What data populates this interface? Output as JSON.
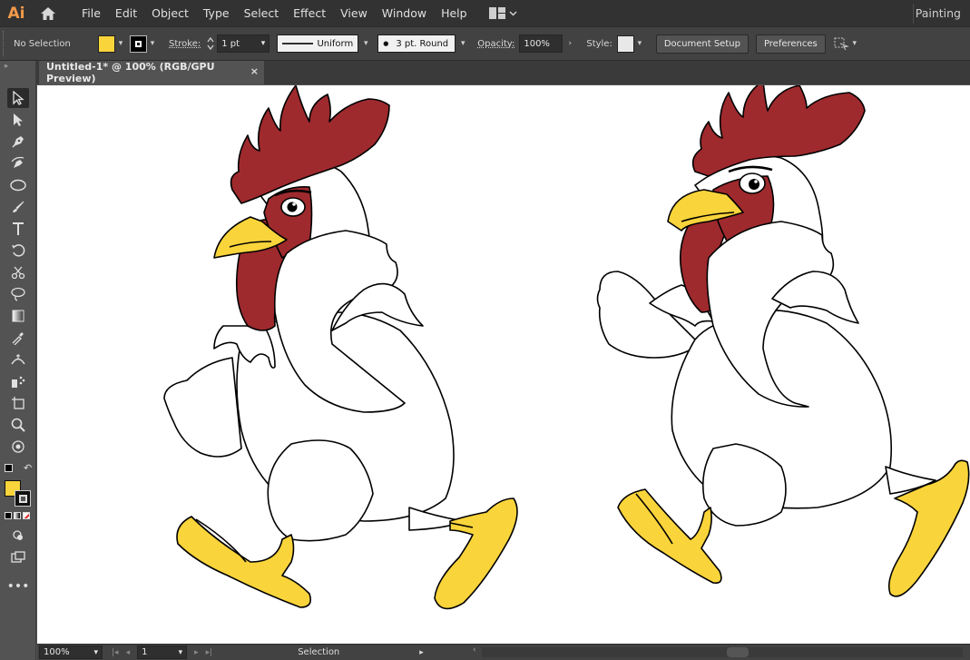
{
  "app": {
    "logo": "Ai",
    "workspace": "Painting"
  },
  "menu": [
    "File",
    "Edit",
    "Object",
    "Type",
    "Select",
    "Effect",
    "View",
    "Window",
    "Help"
  ],
  "control": {
    "selection_status": "No Selection",
    "fill_color": "#f9d43b",
    "stroke_label": "Stroke:",
    "stroke_weight": "1 pt",
    "stroke_profile": "Uniform",
    "brush": "3 pt. Round",
    "opacity_label": "Opacity:",
    "opacity": "100%",
    "style_label": "Style:",
    "document_setup": "Document Setup",
    "preferences": "Preferences"
  },
  "document": {
    "tab_title": "Untitled-1* @ 100% (RGB/GPU Preview)",
    "close_glyph": "×"
  },
  "status": {
    "zoom": "100%",
    "artboard": "1",
    "tool": "Selection"
  },
  "colors": {
    "comb": "#9e2a2e",
    "beak": "#f9d43b",
    "feet": "#f9d43b",
    "body": "#ffffff",
    "outline": "#000000"
  },
  "tools": [
    "selection-tool-icon",
    "direct-selection-tool-icon",
    "pen-tool-icon",
    "curvature-tool-icon",
    "ellipse-tool-icon",
    "paintbrush-tool-icon",
    "type-tool-icon",
    "rotate-tool-icon",
    "scissors-tool-icon",
    "lasso-tool-icon",
    "gradient-tool-icon",
    "eyedropper-tool-icon",
    "width-tool-icon",
    "symbol-sprayer-tool-icon",
    "artboard-tool-icon",
    "zoom-tool-icon",
    "live-paint-tool-icon"
  ]
}
